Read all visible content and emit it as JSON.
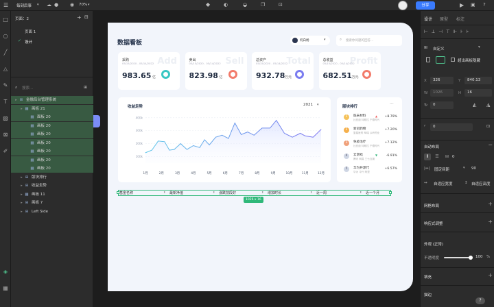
{
  "topbar": {
    "project": "每刻后事",
    "zoom": "70%",
    "share": "分享"
  },
  "layers": {
    "pages_label": "页面：2",
    "pages": [
      "页面 1",
      "设计"
    ],
    "search_placeholder": "搜索...",
    "items": [
      {
        "label": "金融后台管理系统",
        "depth": 0,
        "selected": true,
        "icon": "frame"
      },
      {
        "label": "画板 21",
        "depth": 1,
        "selected": true,
        "icon": "board"
      },
      {
        "label": "面板 20",
        "depth": 2,
        "selected": true,
        "icon": "board"
      },
      {
        "label": "画板 20",
        "depth": 2,
        "selected": true,
        "icon": "board"
      },
      {
        "label": "画板 20",
        "depth": 2,
        "selected": true,
        "icon": "board"
      },
      {
        "label": "画板 20",
        "depth": 2,
        "selected": true,
        "icon": "board"
      },
      {
        "label": "画板 20",
        "depth": 2,
        "selected": true,
        "icon": "board"
      },
      {
        "label": "画板 20",
        "depth": 2,
        "selected": true,
        "icon": "board"
      },
      {
        "label": "画板 20",
        "depth": 2,
        "selected": true,
        "icon": "board"
      },
      {
        "label": "版块排行",
        "depth": 1,
        "selected": false,
        "icon": "frame"
      },
      {
        "label": "收益走势",
        "depth": 1,
        "selected": false,
        "icon": "frame"
      },
      {
        "label": "画板 11",
        "depth": 1,
        "selected": false,
        "icon": "board"
      },
      {
        "label": "画板 7",
        "depth": 1,
        "selected": false,
        "icon": "frame"
      },
      {
        "label": "Left Side",
        "depth": 1,
        "selected": false,
        "icon": "frame"
      }
    ]
  },
  "props": {
    "tabs": [
      "设计",
      "原型",
      "标注"
    ],
    "custom": "自定义",
    "clip": "超出画板隐藏",
    "x_label": "X",
    "x_val": "326",
    "y_label": "Y",
    "y_val": "840.13",
    "w_label": "W",
    "w_val": "1026",
    "h_label": "H",
    "h_val": "16",
    "rot_val": "0",
    "radius_val": "0",
    "auto_layout": "自动布局",
    "gap_val": "0",
    "spacing_mode": "固定间距",
    "spacing_val": "90",
    "fit_w": "自适应宽度",
    "fit_h": "自适应高度",
    "grid": "网格布局",
    "constraints": "响应式调整",
    "appearance": "外观 (正常)",
    "opacity_label": "不透明度",
    "opacity_val": "100",
    "opacity_unit": "%",
    "fill": "填充",
    "stroke": "描边"
  },
  "dashboard": {
    "title": "数据看板",
    "user": "何白杨",
    "search_placeholder": "搜索你问题的回答...",
    "kpis": [
      {
        "title": "采购",
        "date": "05/15/2020 - 05/14/2022",
        "value": "983.65",
        "unit": "亿",
        "watermark": "Add",
        "color": "#38c7c3"
      },
      {
        "title": "卖出",
        "date": "05/15/2020 - 05/14/2022",
        "value": "823.98",
        "unit": "亿",
        "watermark": "Sell",
        "color": "#f27b6b"
      },
      {
        "title": "总资产",
        "date": "05/15/2020 - 05/14/2022",
        "value": "932.78",
        "unit": "万元",
        "watermark": "Total",
        "color": "#7a7cf0"
      },
      {
        "title": "总收益",
        "date": "05/15/2020 - 05/14/2022",
        "value": "682.51",
        "unit": "万元",
        "watermark": "Profit",
        "color": "#f27b6b"
      }
    ],
    "trend_title": "收益走势",
    "trend_year": "2021",
    "rank_title": "版块排行",
    "rank_more": "···",
    "ranks": [
      {
        "n": "1",
        "name": "既未材料",
        "desc": "比亚迪 特斯拉 宁德时代",
        "pct": "+8.79%",
        "arrow": "▲",
        "color": "#f5c25b",
        "arrow_color": "#ef5b5b"
      },
      {
        "n": "2",
        "name": "新冠药物",
        "desc": "复星医药 辉瑞 以岭药业",
        "pct": "+7.20%",
        "arrow": "",
        "color": "#f5b04c",
        "arrow_color": "#ef5b5b"
      },
      {
        "n": "3",
        "name": "免疫治疗",
        "desc": "比亚迪 特斯拉 宁德时代",
        "pct": "+7.12%",
        "arrow": "",
        "color": "#f0a17b",
        "arrow_color": "#ef5b5b"
      },
      {
        "n": "4",
        "name": "云游戏",
        "desc": "腾讯 网易 三七互娱",
        "pct": "-6.91%",
        "arrow": "▼",
        "color": "#cfd6e4",
        "arrow_color": "#32b67a"
      },
      {
        "n": "5",
        "name": "华为开源代",
        "desc": "华为 中兴 阿里",
        "pct": "+6.57%",
        "arrow": "",
        "color": "#cfd6e4",
        "arrow_color": "#ef5b5b"
      }
    ],
    "table_headers": [
      "基金名称",
      "最新净值",
      "涨跌前段好",
      "增加时长",
      "近一周",
      "近一个月"
    ],
    "size_badge": "1026 x 16"
  },
  "chart_data": {
    "type": "line",
    "categories": [
      "1月",
      "2月",
      "3月",
      "4月",
      "5月",
      "6月",
      "7月",
      "8月",
      "9月",
      "10月",
      "11月",
      "12月"
    ],
    "yticks": [
      "100k",
      "200k",
      "300k",
      "400k"
    ],
    "ylim": [
      50,
      420
    ],
    "x": [
      1,
      1.4,
      1.8,
      2.2,
      2.5,
      2.8,
      3.2,
      3.6,
      4.0,
      4.4,
      4.7,
      5.0,
      5.4,
      5.8,
      6.2,
      6.6,
      7.0,
      7.4,
      7.8,
      8.3,
      8.8,
      9.2,
      9.7,
      10.2,
      10.7,
      11.0,
      11.5,
      12.0
    ],
    "values": [
      130,
      150,
      220,
      215,
      150,
      155,
      200,
      155,
      185,
      170,
      230,
      190,
      250,
      265,
      240,
      360,
      270,
      290,
      265,
      320,
      320,
      380,
      280,
      250,
      280,
      260,
      250,
      310
    ],
    "series_color": "#6e9ff0"
  }
}
